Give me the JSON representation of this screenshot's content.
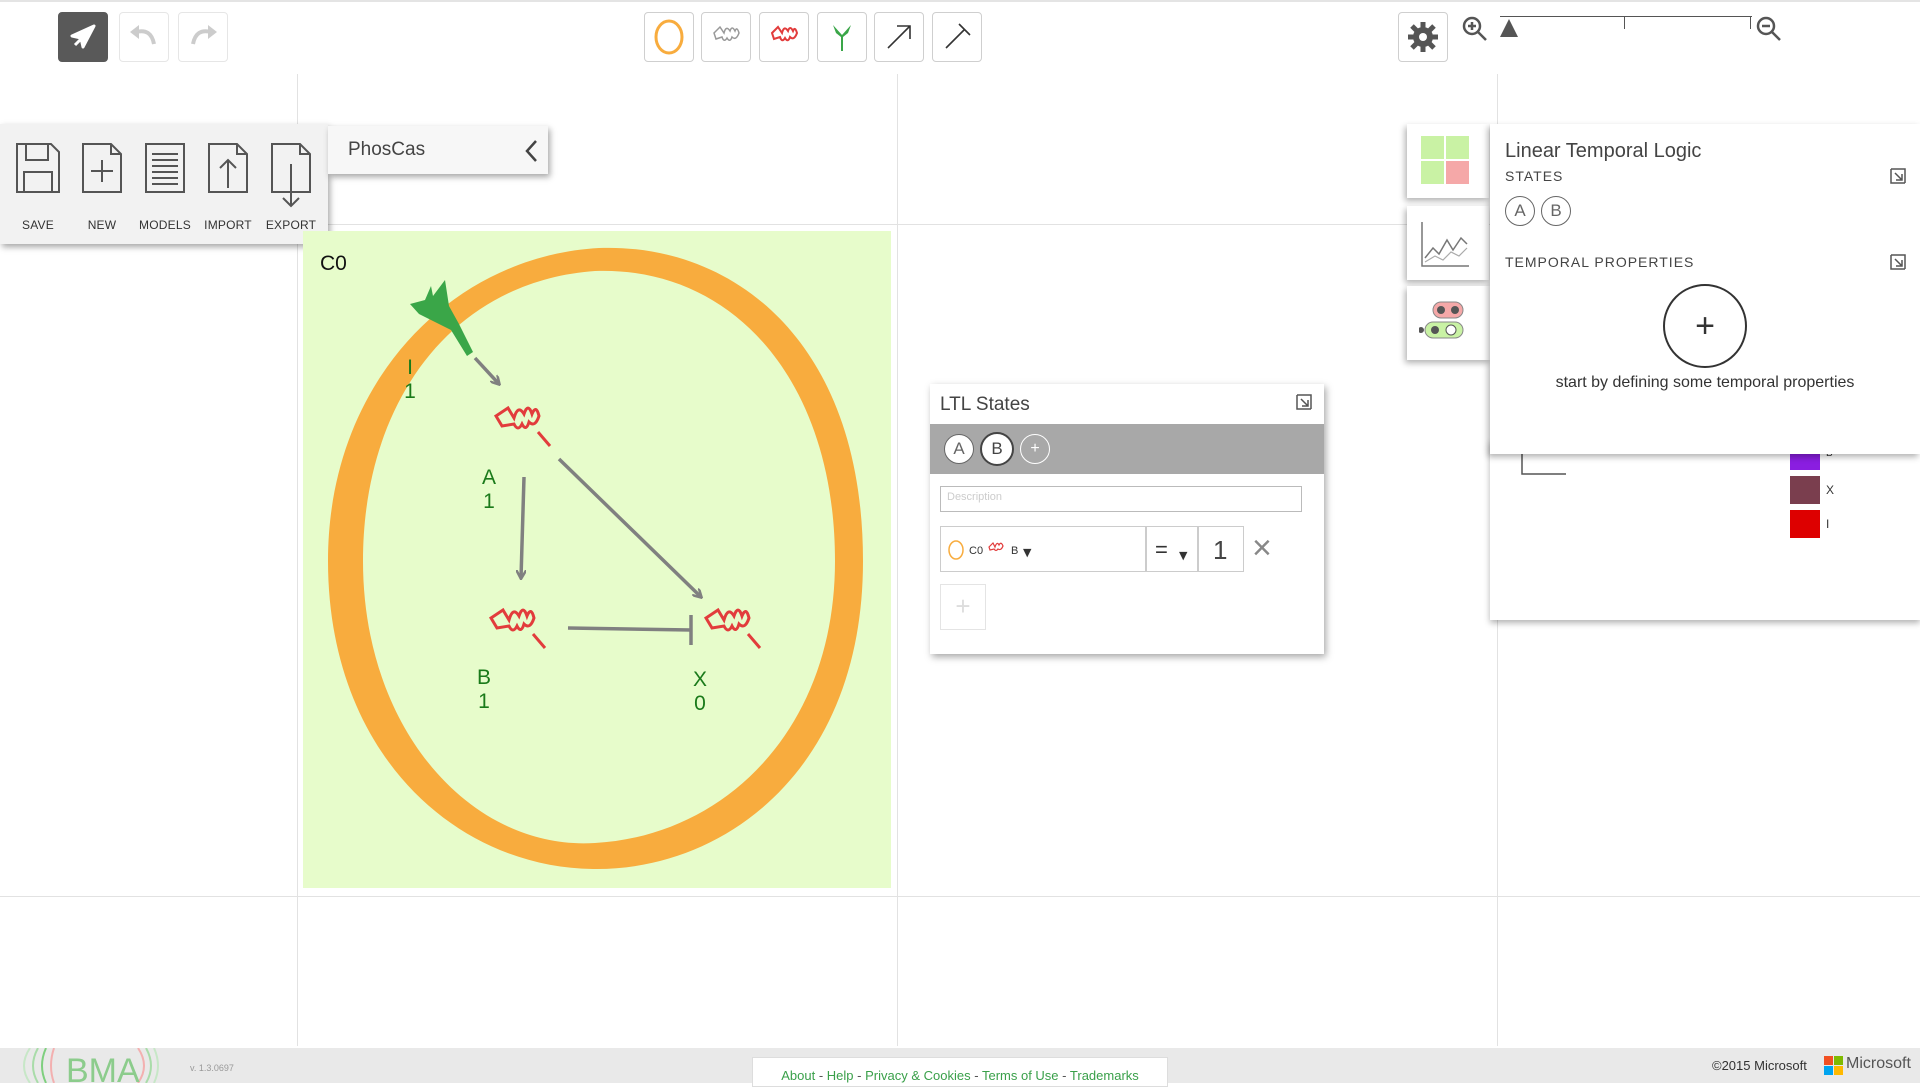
{
  "toolbar": {
    "tools": [
      "select-tool",
      "undo",
      "redo"
    ],
    "palette": [
      "cell-container",
      "variable",
      "constant",
      "receptor",
      "activator-edge",
      "inhibitor-edge"
    ]
  },
  "file_menu": {
    "items": [
      {
        "label": "SAVE",
        "icon": "save-icon"
      },
      {
        "label": "NEW",
        "icon": "new-icon"
      },
      {
        "label": "MODELS",
        "icon": "models-icon"
      },
      {
        "label": "IMPORT",
        "icon": "import-icon"
      },
      {
        "label": "EXPORT",
        "icon": "export-icon"
      }
    ],
    "model_name": "PhosCas"
  },
  "canvas": {
    "cell_name": "C0",
    "variables": [
      {
        "name": "I",
        "value": "1"
      },
      {
        "name": "A",
        "value": "1"
      },
      {
        "name": "B",
        "value": "1"
      },
      {
        "name": "X",
        "value": "0"
      }
    ]
  },
  "ltl_states": {
    "title": "LTL States",
    "states": [
      "A",
      "B"
    ],
    "add_label": "+",
    "description_placeholder": "Description",
    "row": {
      "container": "C0",
      "variable": "B",
      "operator": "=",
      "value": "1",
      "remove": "×"
    },
    "add_row": "+"
  },
  "temporal_logic": {
    "title": "Linear Temporal Logic",
    "states_heading": "STATES",
    "states": [
      "A",
      "B"
    ],
    "properties_heading": "TEMPORAL PROPERTIES",
    "add_label": "+",
    "hint": "start by defining some temporal properties"
  },
  "legend": [
    {
      "label": "B",
      "color": "#8a1ee0"
    },
    {
      "label": "X",
      "color": "#7a3e4e"
    },
    {
      "label": "I",
      "color": "#dd0000"
    }
  ],
  "footer": {
    "links": [
      "About",
      "Help",
      "Privacy & Cookies",
      "Terms of Use",
      "Trademarks"
    ],
    "separator": "-",
    "copyright": "©2015 Microsoft",
    "brand": "Microsoft",
    "app_logo": "BMA",
    "version": "v. 1.3.0697"
  },
  "colors": {
    "cell_fill": "#e7fccb",
    "membrane": "#f8ac3e",
    "variable": "#e23c3c",
    "receptor": "#3aa648",
    "edge": "#808080",
    "label": "#1a7a1a"
  }
}
